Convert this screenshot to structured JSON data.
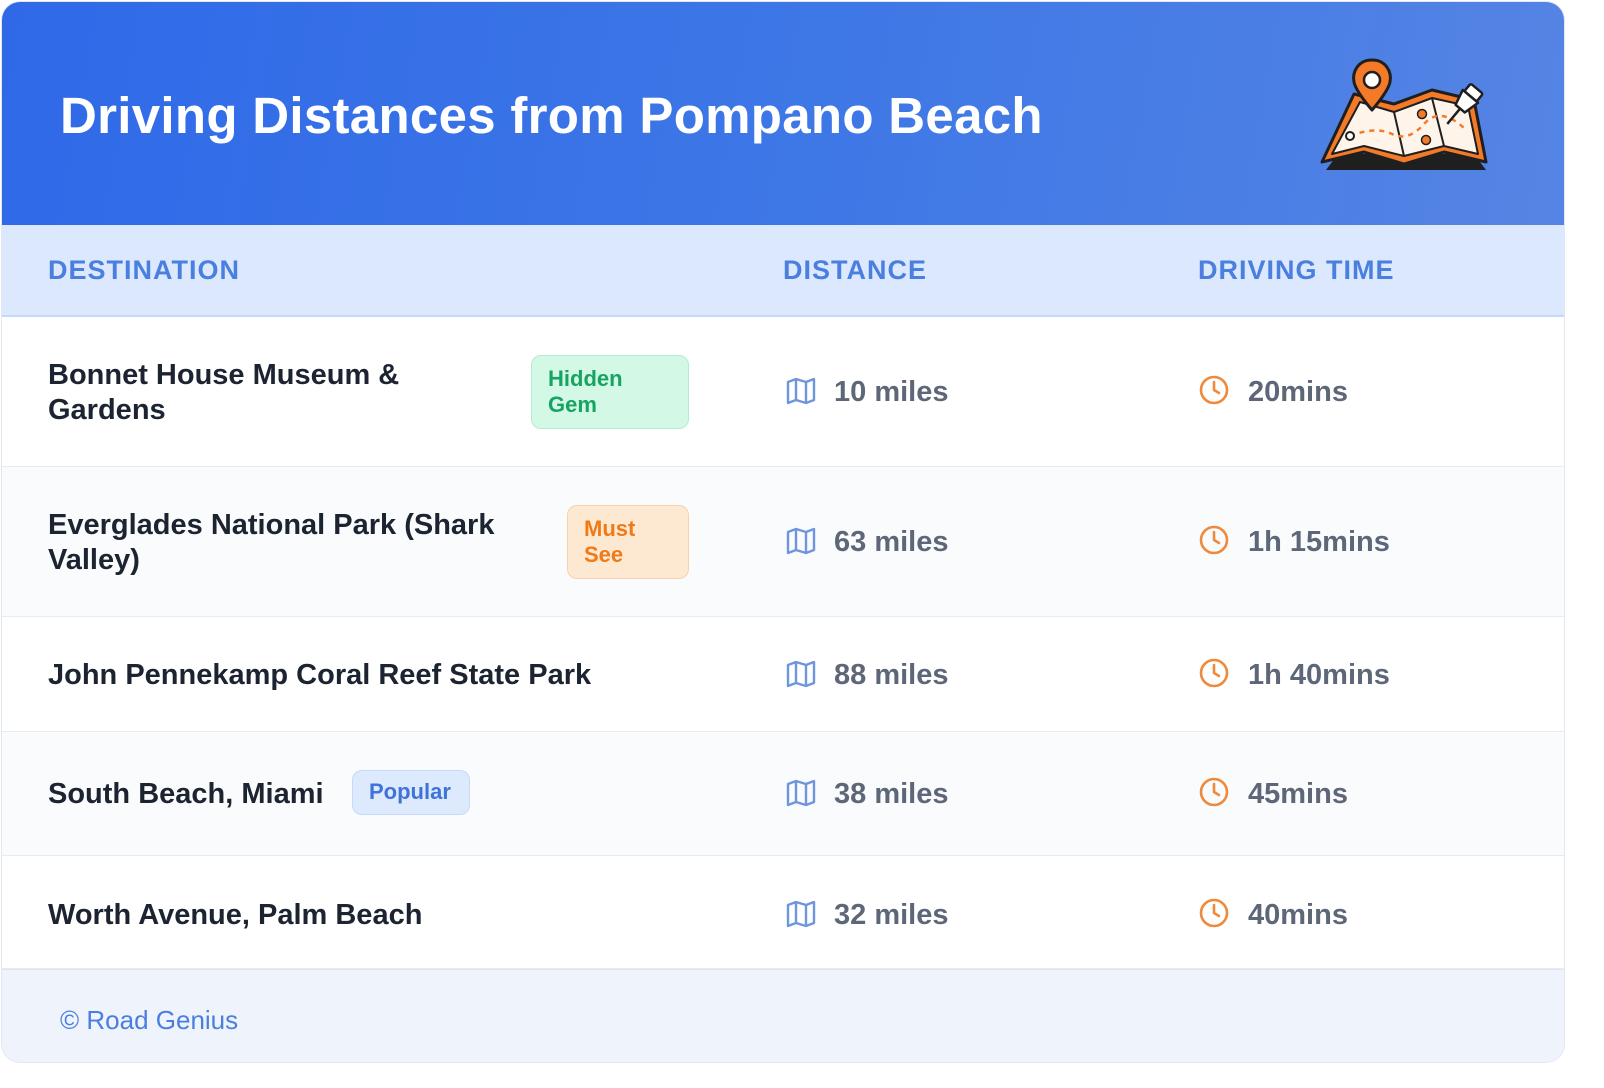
{
  "header": {
    "title": "Driving Distances from Pompano Beach"
  },
  "table": {
    "columns": [
      "DESTINATION",
      "DISTANCE",
      "DRIVING TIME"
    ],
    "rows": [
      {
        "destination": "Bonnet House Museum & Gardens",
        "badge": "Hidden Gem",
        "distance": "10 miles",
        "time": "20mins"
      },
      {
        "destination": "Everglades National Park (Shark Valley)",
        "badge": "Must See",
        "distance": "63 miles",
        "time": "1h 15mins"
      },
      {
        "destination": "John Pennekamp Coral Reef State Park",
        "badge": "",
        "distance": "88 miles",
        "time": "1h 40mins"
      },
      {
        "destination": "South Beach, Miami",
        "badge": "Popular",
        "distance": "38 miles",
        "time": "45mins"
      },
      {
        "destination": "Worth Avenue, Palm Beach",
        "badge": "",
        "distance": "32 miles",
        "time": "40mins"
      }
    ]
  },
  "icons": {
    "header": "map-with-pins-icon",
    "distance": "map-icon",
    "time": "clock-icon"
  },
  "colors": {
    "header_start": "#2f69e8",
    "header_end": "#5584e4",
    "column_header": "#4a7fe0",
    "badge_hidden_gem": "#17a462",
    "badge_must_see": "#f07a16",
    "badge_popular": "#3f73d9",
    "clock_icon": "#ef8a3c",
    "map_icon": "#6f95dd"
  },
  "footer": {
    "text": "© Road Genius"
  }
}
